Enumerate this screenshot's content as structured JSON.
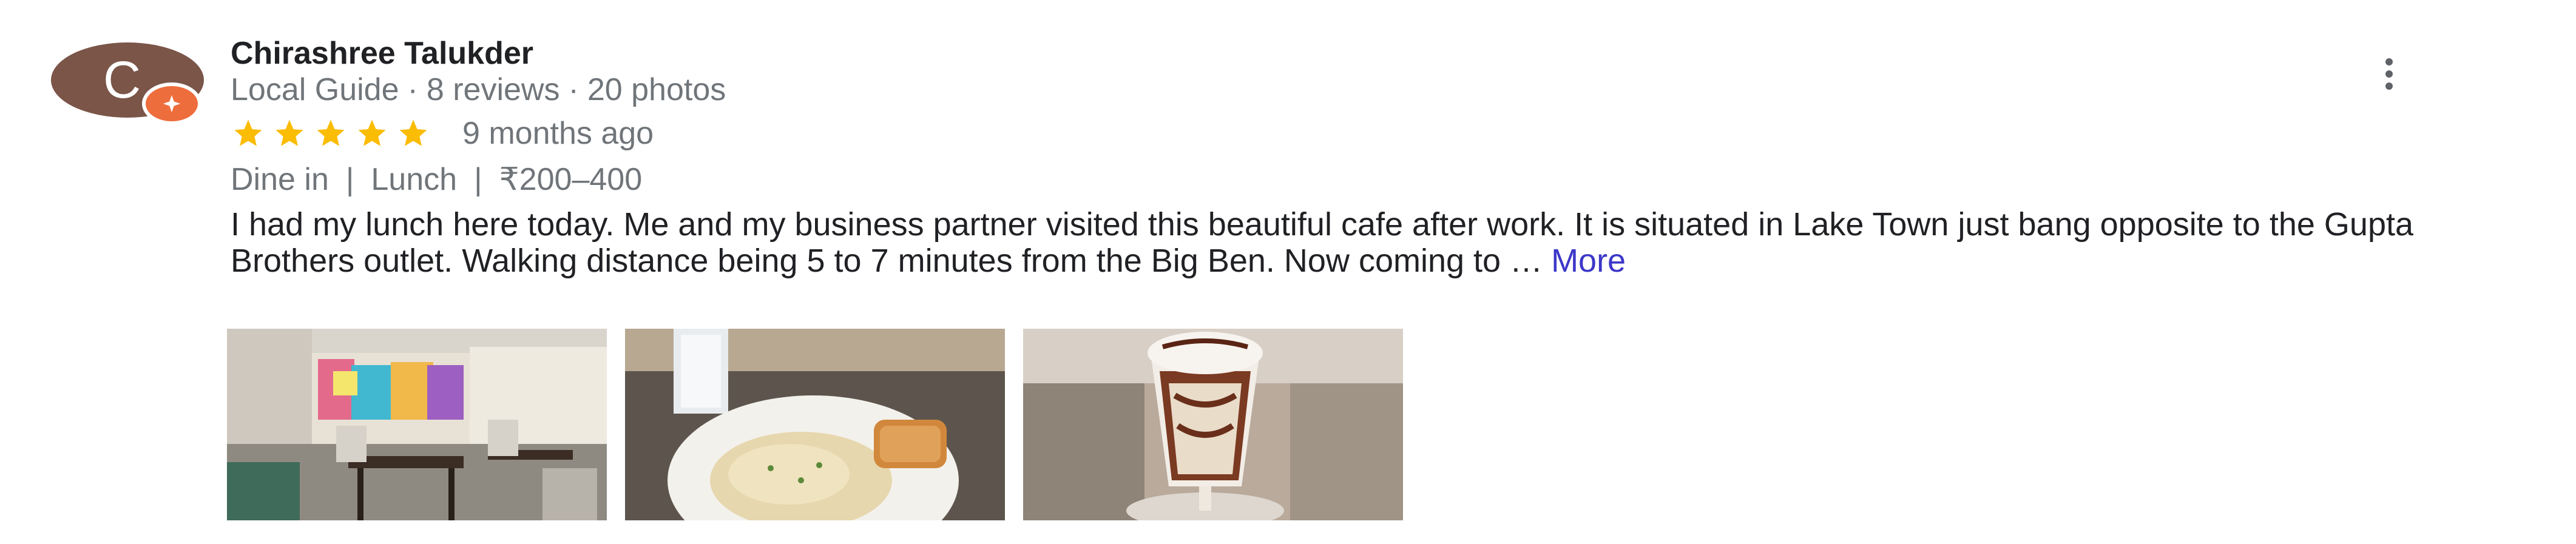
{
  "review": {
    "author": {
      "name": "Chirashree Talukder",
      "avatar_letter": "C",
      "avatar_color": "#7a5548",
      "badge_color": "#ee6d3c",
      "badge_icon": "local-guide-star-icon"
    },
    "meta": {
      "guide_label": "Local Guide",
      "separator": "·",
      "reviews": "8 reviews",
      "photos": "20 photos"
    },
    "rating": {
      "stars": 5,
      "max_stars": 5,
      "star_color": "#fbbc04",
      "time_ago": "9 months ago"
    },
    "tags": {
      "service": "Dine in",
      "meal": "Lunch",
      "price": "₹200–400",
      "separator": "|"
    },
    "text": "I had my lunch here today. Me and my business partner visited this beautiful cafe after work. It is situated in Lake Town just bang opposite to the Gupta Brothers outlet. Walking distance being 5 to 7 minutes from the Big Ben. Now coming to …",
    "more_label": "More",
    "menu_icon": "more-vert-icon",
    "photos": [
      {
        "name": "cafe-interior-photo",
        "subject": "cafe interior with colorful mural"
      },
      {
        "name": "pasta-and-toast-photo",
        "subject": "plate of pasta with toast and a drink"
      },
      {
        "name": "chocolate-shake-photo",
        "subject": "chocolate milkshake in glass"
      }
    ]
  }
}
